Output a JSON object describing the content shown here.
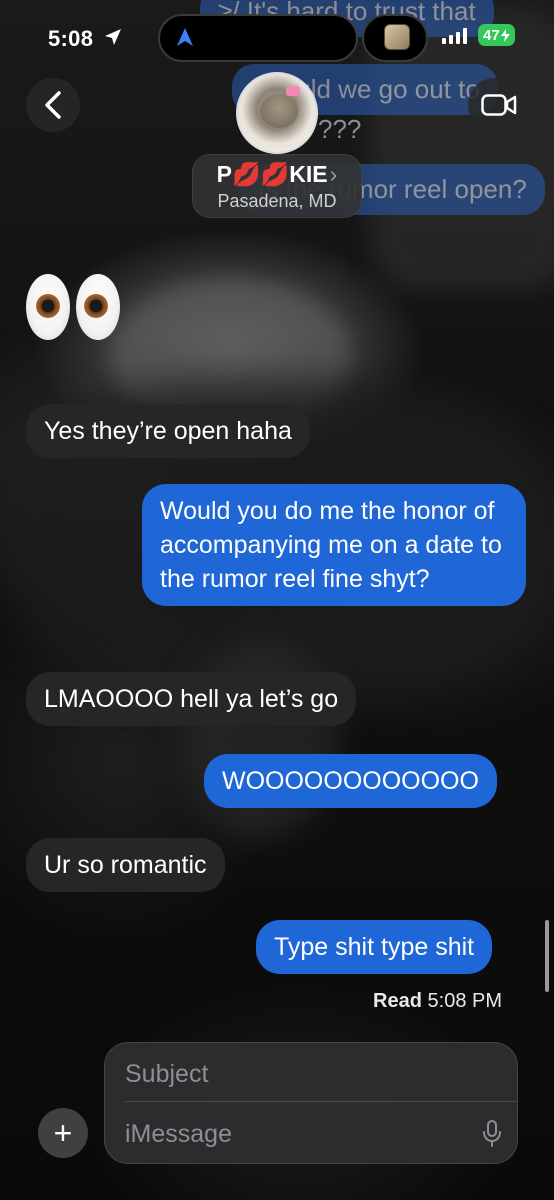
{
  "status_bar": {
    "time": "5:08",
    "battery": "47",
    "icons": [
      "location-arrow-icon",
      "navigation-icon",
      "now-playing-artwork",
      "signal-icon",
      "battery-charging-icon"
    ]
  },
  "header": {
    "back_icon": "chevron-left-icon",
    "video_icon": "video-camera-icon",
    "contact": {
      "name": "P💋💋KIE",
      "chevron": "›",
      "location": "Pasadena, MD"
    }
  },
  "ghost_messages": [
    "≥/ It's hard to trust that",
    "Should we go out to",
    "???",
    "Is the rumor reel open?"
  ],
  "messages": [
    {
      "type": "emoji",
      "text": "👀"
    },
    {
      "type": "received",
      "text": "Yes they’re open haha"
    },
    {
      "type": "sent",
      "text": "Would you do me the honor of accompanying me on a date to the rumor reel fine shyt?"
    },
    {
      "type": "received",
      "text": "LMAOOOO hell ya let’s go"
    },
    {
      "type": "sent",
      "text": "WOOOOOOOOOOOO"
    },
    {
      "type": "received",
      "text": "Ur so romantic"
    },
    {
      "type": "sent",
      "text": "Type shit type shit"
    }
  ],
  "read_receipt": {
    "label": "Read",
    "time": "5:08 PM"
  },
  "compose": {
    "plus_label": "+",
    "subject_placeholder": "Subject",
    "message_placeholder": "iMessage",
    "mic_icon": "microphone-icon"
  },
  "colors": {
    "sent_bubble": "#1f66d6",
    "received_bubble": "#262628",
    "battery": "#34c759"
  }
}
